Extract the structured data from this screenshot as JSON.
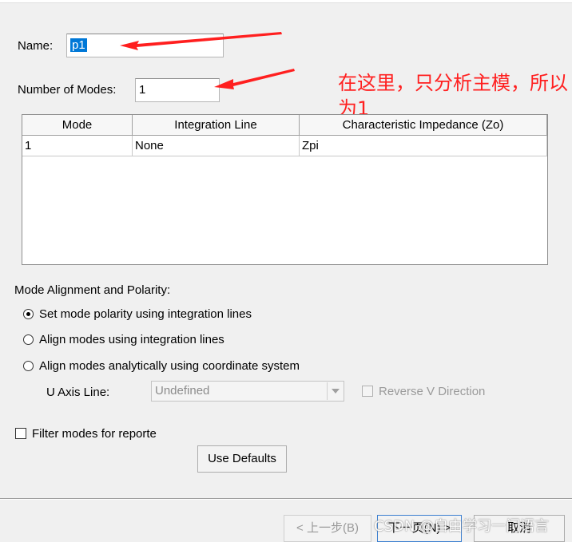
{
  "form": {
    "name_label": "Name:",
    "name_value": "p1",
    "modes_label": "Number of Modes:",
    "modes_value": "1"
  },
  "table": {
    "columns": [
      "Mode",
      "Integration Line",
      "Characteristic Impedance (Zo)"
    ],
    "rows": [
      [
        "1",
        "None",
        "Zpi"
      ]
    ]
  },
  "alignment": {
    "title": "Mode Alignment and Polarity:",
    "options": [
      "Set mode polarity using integration lines",
      "Align modes using integration lines",
      "Align modes analytically using coordinate system"
    ],
    "selected_index": 0,
    "u_axis_label": "U Axis Line:",
    "u_axis_value": "Undefined",
    "reverse_label": "Reverse V Direction"
  },
  "filter_label": "Filter modes for reporte",
  "use_defaults_label": "Use Defaults",
  "nav": {
    "back_label": "< 上一步(B)",
    "next_label": "下一页(N) >",
    "cancel_label": "取消"
  },
  "annotation": {
    "text": "在这里，只分析主模，所以为1",
    "color": "#ff1f1f"
  },
  "watermark": "CSDN @自由学习一门语言",
  "colors": {
    "selection": "#0078d7",
    "arrow": "#ff1f1f",
    "background": "#f0f0f0"
  }
}
